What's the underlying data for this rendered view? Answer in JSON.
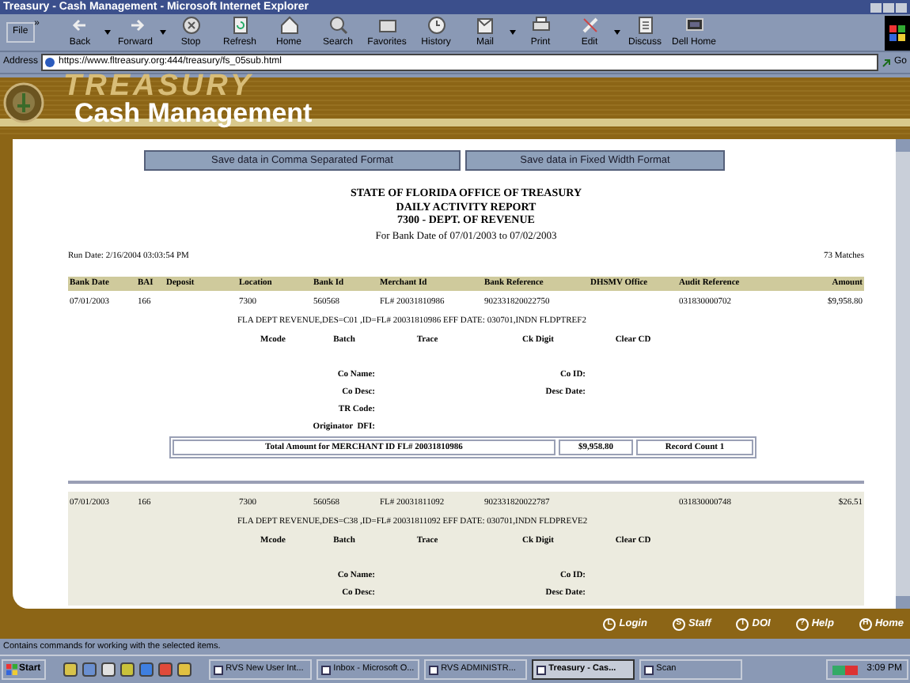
{
  "window": {
    "title": "Treasury - Cash Management - Microsoft Internet Explorer"
  },
  "toolbar": {
    "buttons": [
      {
        "label": "Back",
        "dropdown": true
      },
      {
        "label": "Forward",
        "dropdown": true
      },
      {
        "label": "Stop",
        "dropdown": false
      },
      {
        "label": "Refresh",
        "dropdown": false
      },
      {
        "label": "Home",
        "dropdown": false
      },
      {
        "label": "Search",
        "dropdown": false
      },
      {
        "label": "Favorites",
        "dropdown": false
      },
      {
        "label": "History",
        "dropdown": false
      },
      {
        "label": "Mail",
        "dropdown": true
      },
      {
        "label": "Print",
        "dropdown": false
      },
      {
        "label": "Edit",
        "dropdown": true
      },
      {
        "label": "Discuss",
        "dropdown": false
      },
      {
        "label": "Dell Home",
        "dropdown": false
      }
    ],
    "menu": "File",
    "chevron": "»"
  },
  "address": {
    "label": "Address",
    "url": "https://www.fltreasury.org:444/treasury/fs_05sub.html",
    "go": "Go"
  },
  "banner": {
    "watermark": "TREASURY",
    "title": "Cash Management"
  },
  "export_buttons": [
    "Save data in Comma Separated Format",
    "Save data in Fixed Width Format"
  ],
  "report": {
    "heading": [
      "STATE OF FLORIDA OFFICE OF TREASURY",
      "DAILY ACTIVITY REPORT",
      "7300 - DEPT. OF REVENUE"
    ],
    "subtitle": "For Bank Date of 07/01/2003  to 07/02/2003",
    "run_date": "Run Date: 2/16/2004 03:03:54 PM",
    "matches": "73 Matches"
  },
  "table": {
    "columns": [
      "Bank Date",
      "BAI",
      "Deposit",
      "Location",
      "Bank Id",
      "Merchant Id",
      "Bank Reference",
      "DHSMV Office",
      "Audit Reference",
      "Amount"
    ]
  },
  "records": [
    {
      "shaded": false,
      "cells": [
        "07/01/2003",
        "166",
        "",
        "7300",
        "560568",
        "FL# 20031810986",
        "902331820022750",
        "",
        "031830000702",
        "$9,958.80"
      ],
      "description": "FLA DEPT REVENUE,DES=C01 ,ID=FL# 20031810986 EFF DATE: 030701,INDN FLDPTREF2",
      "detail_labels": [
        "Mcode",
        "Batch",
        "Trace",
        "Ck Digit",
        "Clear CD"
      ],
      "field_rows": [
        {
          "left": "Co Name:",
          "right": "Co ID:"
        },
        {
          "left": "Co Desc:",
          "right": "Desc Date:"
        },
        {
          "left": "TR Code:"
        },
        {
          "left": "Originator  DFI:"
        }
      ],
      "total": {
        "label": "Total Amount for MERCHANT ID FL# 20031810986",
        "amount": "$9,958.80",
        "count": "Record Count 1"
      }
    },
    {
      "shaded": true,
      "cells": [
        "07/01/2003",
        "166",
        "",
        "7300",
        "560568",
        "FL# 20031811092",
        "902331820022787",
        "",
        "031830000748",
        "$26.51"
      ],
      "description": "FLA DEPT REVENUE,DES=C38 ,ID=FL# 20031811092 EFF DATE: 030701,INDN FLDPREVE2",
      "detail_labels": [
        "Mcode",
        "Batch",
        "Trace",
        "Ck Digit",
        "Clear CD"
      ],
      "field_rows": [
        {
          "left": "Co Name:",
          "right": "Co ID:"
        },
        {
          "left": "Co Desc:",
          "right": "Desc Date:"
        }
      ]
    }
  ],
  "footer_links": [
    {
      "label": "Login",
      "badge": "L"
    },
    {
      "label": "Staff",
      "badge": "S"
    },
    {
      "label": "DOI",
      "badge": "I"
    },
    {
      "label": "Help",
      "badge": "?"
    },
    {
      "label": "Home",
      "badge": "H"
    }
  ],
  "status_bar": {
    "text": "Contains commands for working with the selected items."
  },
  "taskbar": {
    "start": "Start",
    "tasks": [
      {
        "label": "RVS New User Int...",
        "selected": false
      },
      {
        "label": "Inbox - Microsoft O...",
        "selected": false
      },
      {
        "label": "RVS ADMINISTR...",
        "selected": false
      },
      {
        "label": "Treasury - Cas...",
        "selected": true
      },
      {
        "label": "Scan",
        "selected": false
      }
    ],
    "clock": "3:09 PM"
  }
}
